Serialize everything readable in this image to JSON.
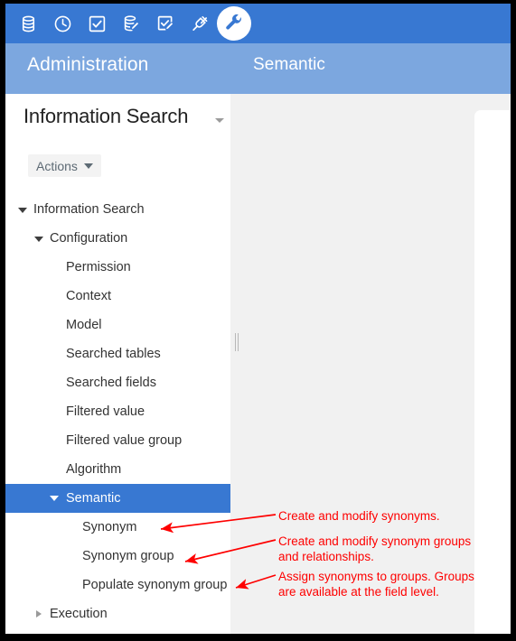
{
  "window": {
    "border_color": "#000000",
    "accent_color": "#3878d2",
    "header_band_color": "#7ca7df",
    "annotation_color": "#fe0000"
  },
  "toolbar": {
    "items": [
      {
        "icon": "database-icon",
        "active": false
      },
      {
        "icon": "clock-icon",
        "active": false
      },
      {
        "icon": "checkbox-checked-icon",
        "active": false
      },
      {
        "icon": "database-edit-icon",
        "active": false
      },
      {
        "icon": "checkbox-edit-icon",
        "active": false
      },
      {
        "icon": "plug-icon",
        "active": false
      },
      {
        "icon": "wrench-icon",
        "active": true
      }
    ]
  },
  "header": {
    "module_title": "Administration",
    "page_title": "Semantic"
  },
  "sidebar": {
    "title": "Information Search",
    "title_caret_icon": "chevron-down-icon",
    "actions": {
      "label": "Actions",
      "caret_icon": "chevron-down-icon"
    },
    "tree": [
      {
        "label": "Information Search",
        "level": 0,
        "state": "expanded",
        "selected": false
      },
      {
        "label": "Configuration",
        "level": 1,
        "state": "expanded",
        "selected": false
      },
      {
        "label": "Permission",
        "level": 2,
        "state": "leaf",
        "selected": false
      },
      {
        "label": "Context",
        "level": 2,
        "state": "leaf",
        "selected": false
      },
      {
        "label": "Model",
        "level": 2,
        "state": "leaf",
        "selected": false
      },
      {
        "label": "Searched tables",
        "level": 2,
        "state": "leaf",
        "selected": false
      },
      {
        "label": "Searched fields",
        "level": 2,
        "state": "leaf",
        "selected": false
      },
      {
        "label": "Filtered value",
        "level": 2,
        "state": "leaf",
        "selected": false
      },
      {
        "label": "Filtered value group",
        "level": 2,
        "state": "leaf",
        "selected": false
      },
      {
        "label": "Algorithm",
        "level": 2,
        "state": "leaf",
        "selected": false
      },
      {
        "label": "Semantic",
        "level": 2,
        "state": "expanded",
        "selected": true
      },
      {
        "label": "Synonym",
        "level": 3,
        "state": "leaf",
        "selected": false
      },
      {
        "label": "Synonym group",
        "level": 3,
        "state": "leaf",
        "selected": false
      },
      {
        "label": "Populate synonym group",
        "level": 3,
        "state": "leaf",
        "selected": false
      },
      {
        "label": "Execution",
        "level": 1,
        "state": "collapsed",
        "selected": false
      }
    ],
    "splitter_icon": "resize-handle-icon"
  },
  "content": {
    "panel_empty": true
  },
  "annotations": [
    {
      "id": "annotation-synonym",
      "text": "Create and modify synonyms.",
      "arrow": "arrow-left-icon"
    },
    {
      "id": "annotation-synonym-group",
      "text": "Create and modify synonym groups\nand relationships.",
      "arrow": "arrow-left-icon"
    },
    {
      "id": "annotation-populate-synonym-group",
      "text": "Assign synonyms to groups. Groups\nare available at the field level.",
      "arrow": "arrow-left-icon"
    }
  ]
}
